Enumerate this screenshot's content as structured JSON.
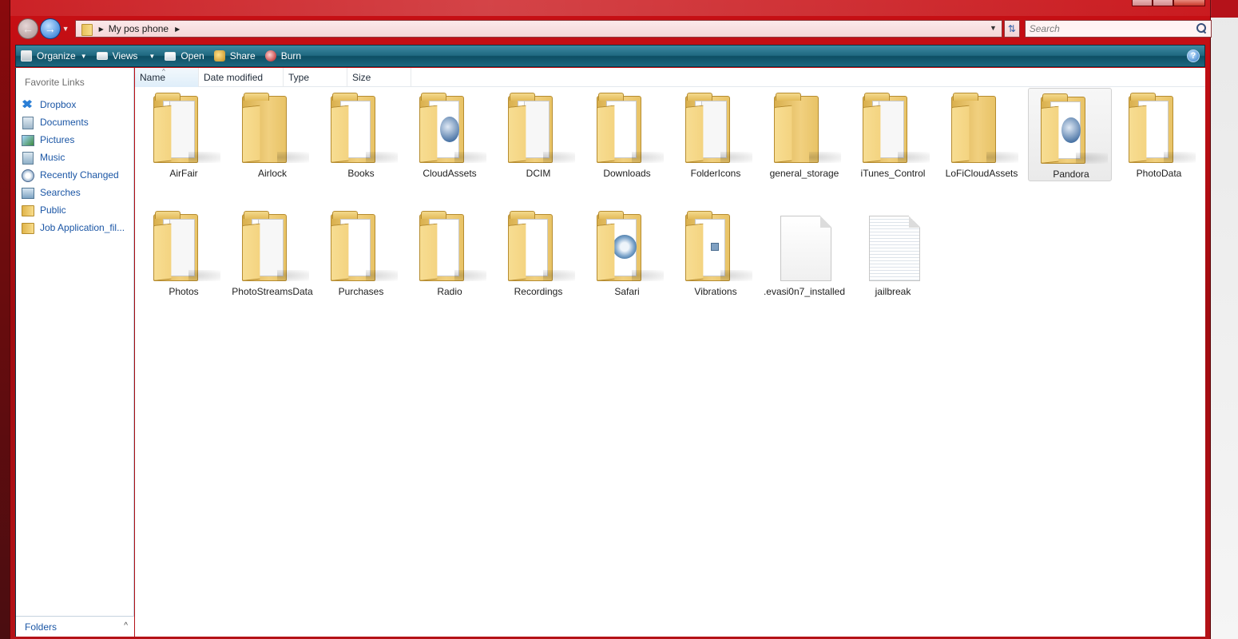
{
  "address": {
    "crumbs": [
      "My pos phone"
    ],
    "search_placeholder": "Search"
  },
  "toolbar": {
    "organize": "Organize",
    "views": "Views",
    "open": "Open",
    "share": "Share",
    "burn": "Burn",
    "help": "?"
  },
  "nav": {
    "heading": "Favorite Links",
    "items": [
      {
        "label": "Dropbox",
        "icon": "dropbox-icon"
      },
      {
        "label": "Documents",
        "icon": "documents-icon"
      },
      {
        "label": "Pictures",
        "icon": "pictures-icon"
      },
      {
        "label": "Music",
        "icon": "music-icon"
      },
      {
        "label": "Recently Changed",
        "icon": "recent-icon"
      },
      {
        "label": "Searches",
        "icon": "searches-icon"
      },
      {
        "label": "Public",
        "icon": "folder-icon"
      },
      {
        "label": "Job Application_fil...",
        "icon": "folder-icon"
      }
    ],
    "folders_label": "Folders"
  },
  "columns": [
    "Name",
    "Date modified",
    "Type",
    "Size"
  ],
  "items": [
    {
      "label": "AirFair",
      "kind": "folder-docs"
    },
    {
      "label": "Airlock",
      "kind": "folder"
    },
    {
      "label": "Books",
      "kind": "folder-paper"
    },
    {
      "label": "CloudAssets",
      "kind": "folder-media"
    },
    {
      "label": "DCIM",
      "kind": "folder-docs"
    },
    {
      "label": "Downloads",
      "kind": "folder-paper"
    },
    {
      "label": "FolderIcons",
      "kind": "folder-docs"
    },
    {
      "label": "general_storage",
      "kind": "folder"
    },
    {
      "label": "iTunes_Control",
      "kind": "folder-docs"
    },
    {
      "label": "LoFiCloudAssets",
      "kind": "folder"
    },
    {
      "label": "Pandora",
      "kind": "folder-media"
    },
    {
      "label": "PhotoData",
      "kind": "folder-paper"
    },
    {
      "label": "Photos",
      "kind": "folder-docs"
    },
    {
      "label": "PhotoStreamsData",
      "kind": "folder-docs"
    },
    {
      "label": "Purchases",
      "kind": "folder-paper"
    },
    {
      "label": "Radio",
      "kind": "folder-paper"
    },
    {
      "label": "Recordings",
      "kind": "folder-paper"
    },
    {
      "label": "Safari",
      "kind": "folder-gear"
    },
    {
      "label": "Vibrations",
      "kind": "folder-small"
    },
    {
      "label": ".evasi0n7_installed",
      "kind": "file"
    },
    {
      "label": "jailbreak",
      "kind": "file-lined"
    }
  ],
  "selected_item": "Pandora"
}
